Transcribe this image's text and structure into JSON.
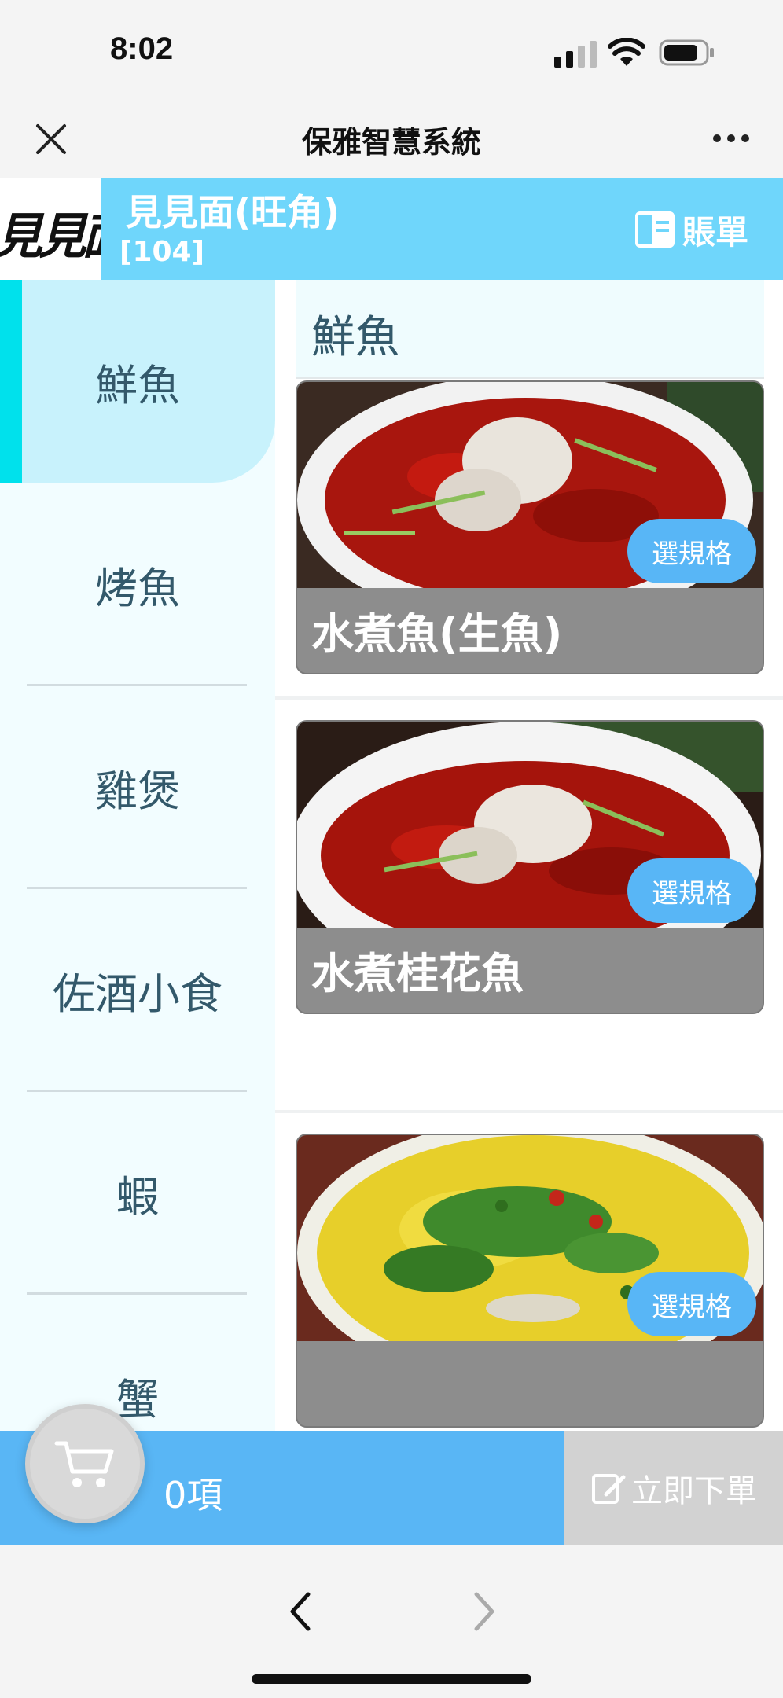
{
  "status_bar": {
    "time": "8:02"
  },
  "nav": {
    "title": "保雅智慧系統"
  },
  "shop": {
    "logo_text": "見見面",
    "name": "見見面(旺角)",
    "table": "[104]",
    "bill_label": "賬單"
  },
  "categories": [
    {
      "label": "鮮魚",
      "active": true
    },
    {
      "label": "烤魚",
      "active": false
    },
    {
      "label": "雞煲",
      "active": false
    },
    {
      "label": "佐酒小食",
      "active": false
    },
    {
      "label": "蝦",
      "active": false
    },
    {
      "label": "蟹",
      "active": false
    }
  ],
  "section": {
    "title": "鮮魚"
  },
  "dishes": [
    {
      "name": "水煮魚(生魚)",
      "spec_label": "選規格"
    },
    {
      "name": "水煮桂花魚",
      "spec_label": "選規格"
    },
    {
      "name": "",
      "spec_label": "選規格"
    }
  ],
  "cart": {
    "count_label": "0項",
    "order_label": "立即下單"
  },
  "colors": {
    "header_blue": "#6fd6fb",
    "accent_cyan": "#00e1ec",
    "button_blue": "#58b6f6",
    "category_text": "#33596b",
    "order_disabled": "#d2d2d2"
  }
}
